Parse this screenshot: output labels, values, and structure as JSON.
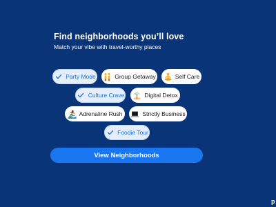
{
  "header": {
    "title": "Find neighborhoods you’ll love",
    "subtitle": "Match your vibe with travel-worthy places"
  },
  "chips": [
    {
      "label": "Party Mode",
      "selected": true,
      "icon": "check-icon"
    },
    {
      "label": "Group Getaway",
      "selected": false,
      "icon": "people-icon"
    },
    {
      "label": "Self Care",
      "selected": false,
      "icon": "meditation-icon"
    },
    {
      "label": "Culture Crave",
      "selected": true,
      "icon": "check-icon"
    },
    {
      "label": "Digital Detox",
      "selected": false,
      "icon": "island-icon"
    },
    {
      "label": "Adrenaline Rush",
      "selected": false,
      "icon": "surfer-icon"
    },
    {
      "label": "Strictly Business",
      "selected": false,
      "icon": "laptop-icon"
    },
    {
      "label": "Foodie Tour",
      "selected": true,
      "icon": "check-icon"
    }
  ],
  "cta": {
    "label": "View Neighborhoods"
  },
  "corner": {
    "text": "p"
  },
  "colors": {
    "background": "#0a3478",
    "accent": "#1976f0",
    "selected_chip_bg": "#e4eefc",
    "selected_chip_text": "#1b6fdc"
  }
}
